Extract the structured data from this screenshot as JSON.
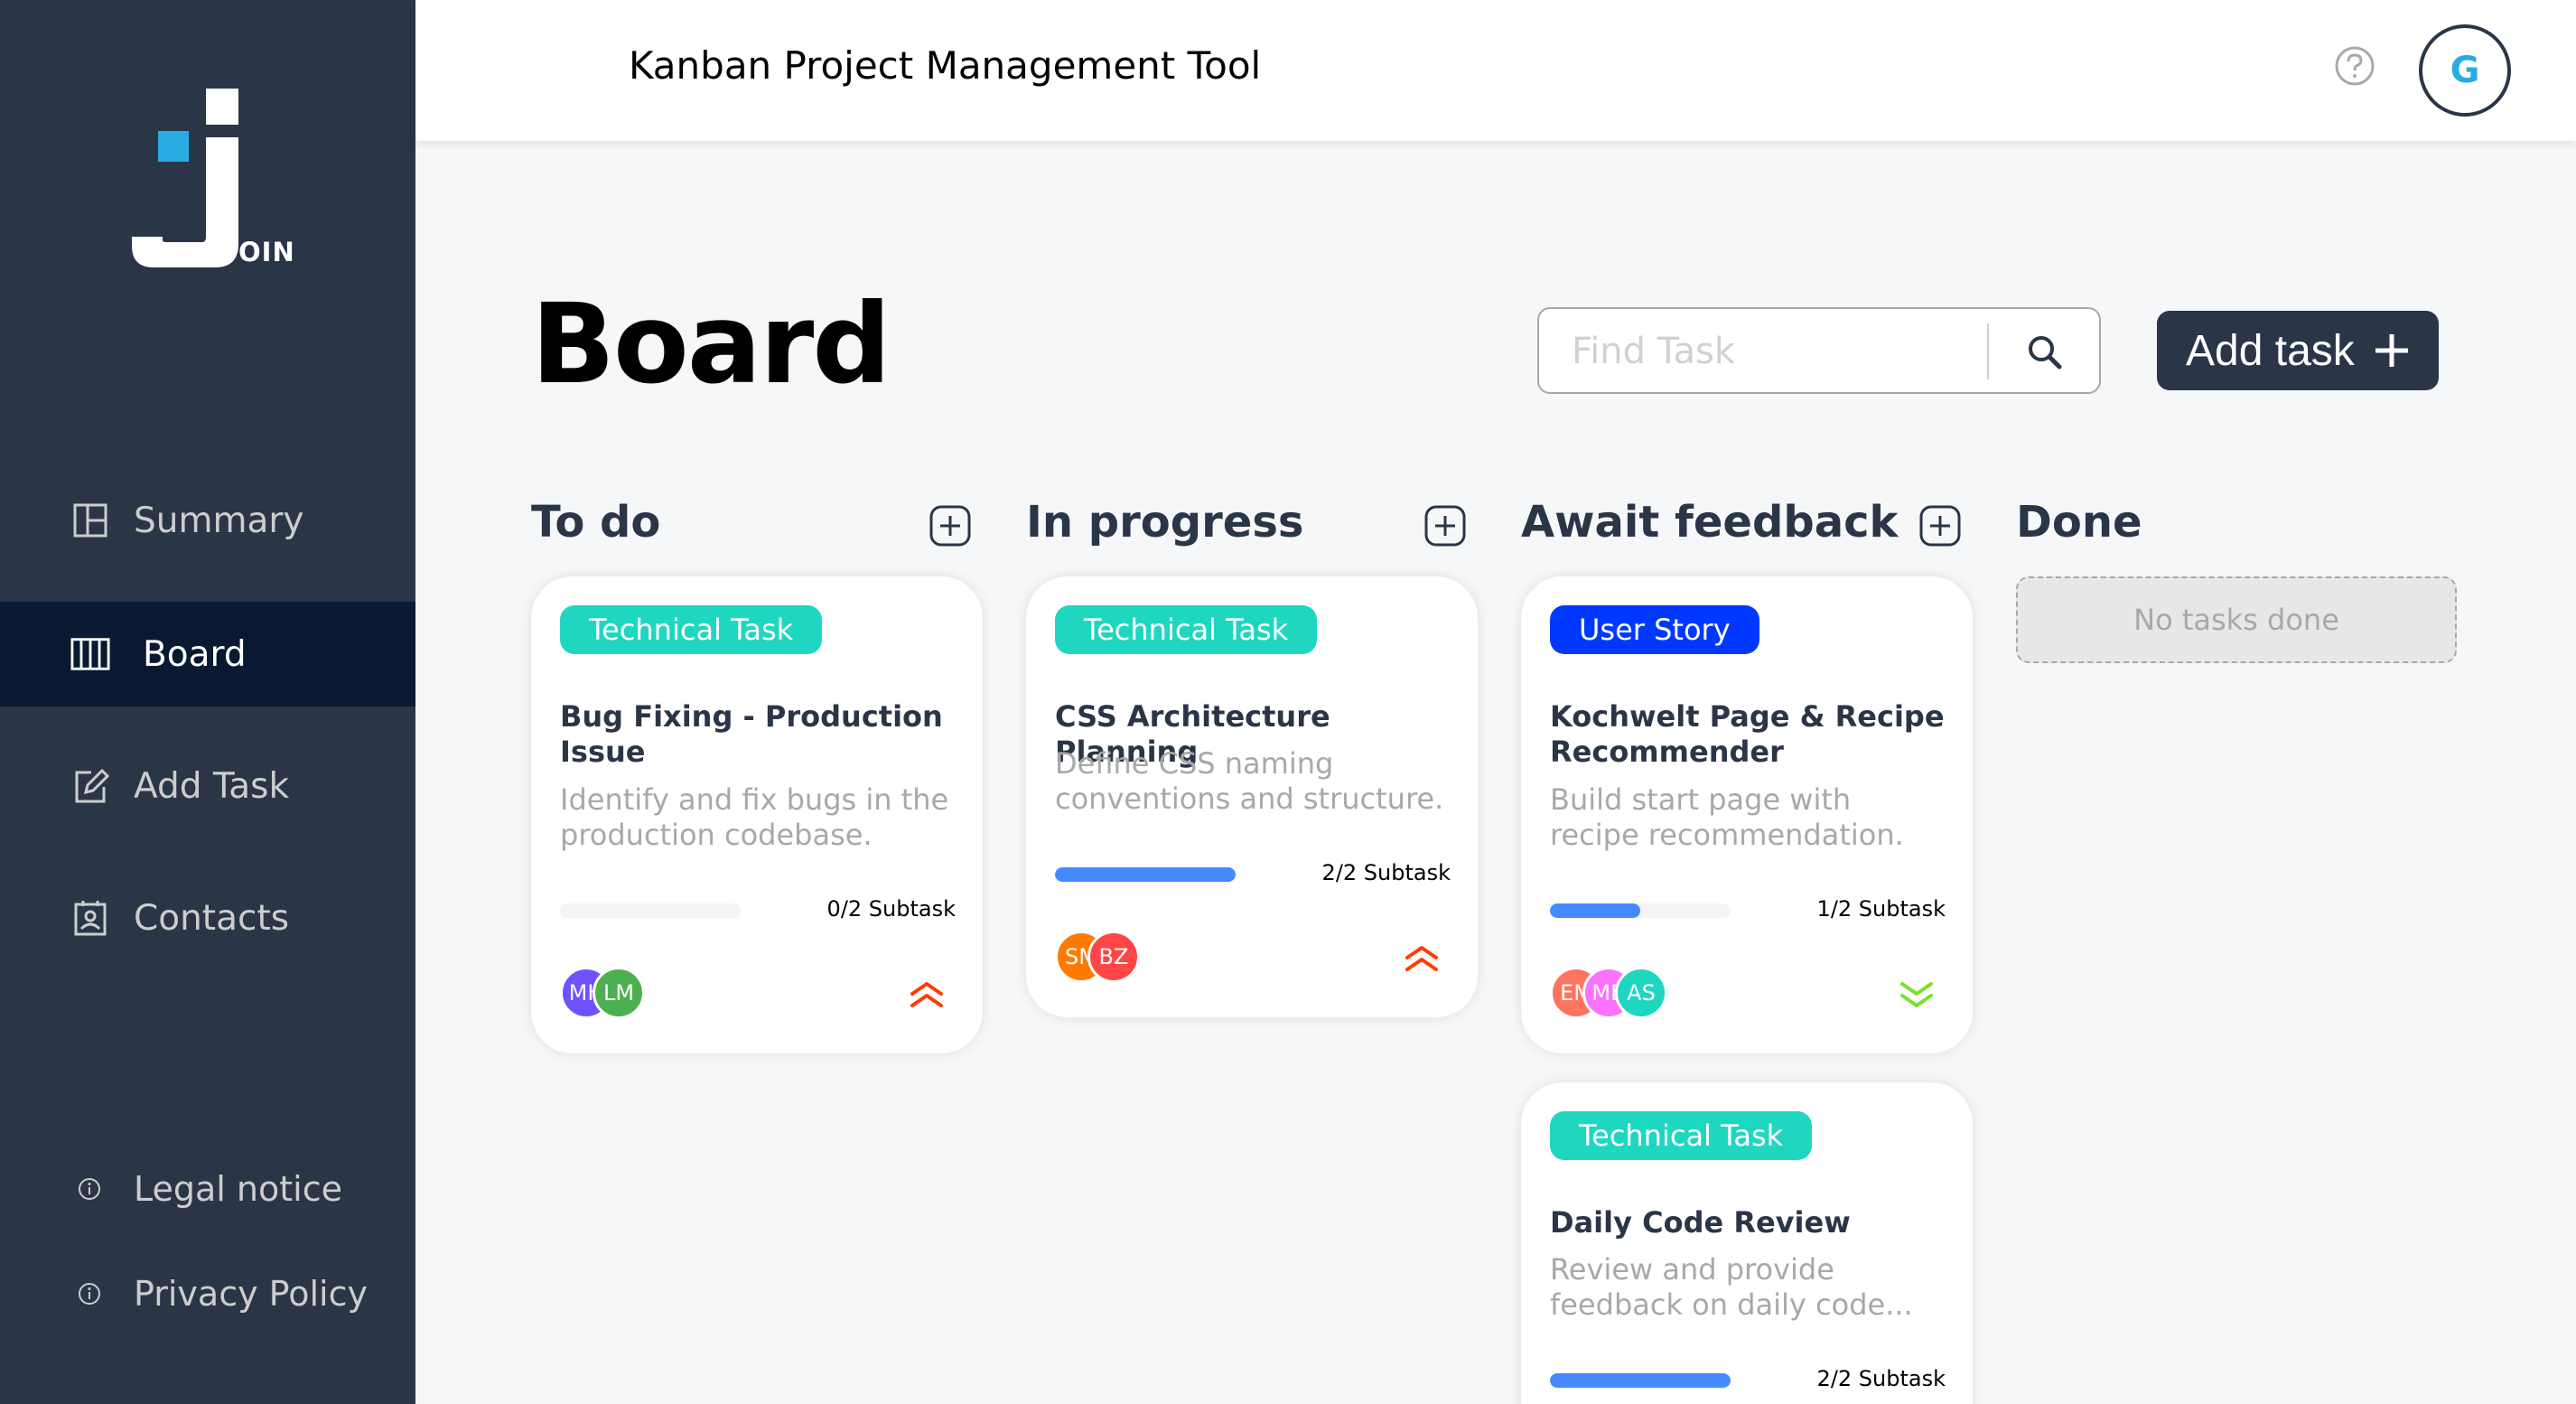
{
  "app": {
    "title": "Kanban Project Management Tool"
  },
  "logo": {
    "text": "OIN"
  },
  "sidebar": {
    "items": [
      {
        "label": "Summary",
        "icon": "summary-icon"
      },
      {
        "label": "Board",
        "icon": "board-icon",
        "active": true
      },
      {
        "label": "Add Task",
        "icon": "add-task-icon"
      },
      {
        "label": "Contacts",
        "icon": "contacts-icon"
      }
    ],
    "footer": [
      {
        "label": "Legal notice",
        "icon": "info-icon"
      },
      {
        "label": "Privacy Policy",
        "icon": "info-icon"
      }
    ]
  },
  "header": {
    "user_initial": "G",
    "help_icon": "help-icon"
  },
  "board": {
    "title": "Board",
    "search_placeholder": "Find Task",
    "add_task_label": "Add task"
  },
  "columns": [
    {
      "title": "To do"
    },
    {
      "title": "In progress"
    },
    {
      "title": "Await feedback"
    },
    {
      "title": "Done",
      "empty_text": "No tasks done"
    }
  ],
  "cards": [
    {
      "category": "Technical Task",
      "title": "Bug Fixing - Production Issue",
      "description": "Identify and fix bugs in the production codebase.",
      "subtasks": "0/2 Subtask",
      "progress": 0,
      "assignees": [
        {
          "initials": "MH",
          "color": "#6e52ff"
        },
        {
          "initials": "LM",
          "color": "#4caf50"
        }
      ],
      "priority": "urgent"
    },
    {
      "category": "Technical Task",
      "title": "CSS Architecture Planning",
      "description": "Define CSS naming conventions and structure.",
      "subtasks": "2/2 Subtask",
      "progress": 1,
      "assignees": [
        {
          "initials": "SM",
          "color": "#ff7a00"
        },
        {
          "initials": "BZ",
          "color": "#ff4646"
        }
      ],
      "priority": "urgent"
    },
    {
      "category": "User Story",
      "title": "Kochwelt Page & Recipe Recommender",
      "description": "Build start page with recipe recommendation.",
      "subtasks": "1/2 Subtask",
      "progress": 0.5,
      "assignees": [
        {
          "initials": "EM",
          "color": "#ff745e"
        },
        {
          "initials": "MB",
          "color": "#fc71ff"
        },
        {
          "initials": "AS",
          "color": "#1fd7c1"
        }
      ],
      "priority": "low"
    },
    {
      "category": "Technical Task",
      "title": "Daily Code Review",
      "description": "Review and provide feedback on daily code...",
      "subtasks": "2/2 Subtask",
      "progress": 1
    }
  ],
  "colors": {
    "sidebar_bg": "#2a3647",
    "sidebar_active": "#091931",
    "technical_tag": "#1fd7c1",
    "user_story_tag": "#0038ff",
    "progress_fill": "#4589ff",
    "urgent": "#ff3d00",
    "low": "#7ae229"
  }
}
